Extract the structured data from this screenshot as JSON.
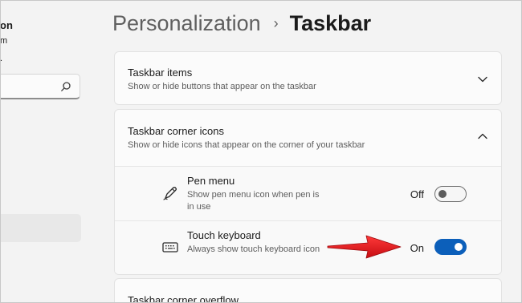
{
  "sidebar": {
    "user_name_fragment": "on",
    "user_sub_fragment": "m",
    "user_dot_fragment": ".",
    "search": {
      "value": "",
      "placeholder": ""
    }
  },
  "header": {
    "parent": "Personalization",
    "separator": "›",
    "current": "Taskbar"
  },
  "cards": {
    "taskbar_items": {
      "title": "Taskbar items",
      "description": "Show or hide buttons that appear on the taskbar"
    },
    "corner_icons": {
      "title": "Taskbar corner icons",
      "description": "Show or hide icons that appear on the corner of your taskbar",
      "rows": [
        {
          "title": "Pen menu",
          "description": "Show pen menu icon when pen is in use",
          "state_label": "Off",
          "enabled": false,
          "icon": "pen-icon"
        },
        {
          "title": "Touch keyboard",
          "description": "Always show touch keyboard icon",
          "state_label": "On",
          "enabled": true,
          "icon": "keyboard-icon"
        }
      ]
    },
    "corner_overflow": {
      "title": "Taskbar corner overflow"
    }
  },
  "colors": {
    "accent": "#0c5fba",
    "annotation_arrow": "#e8141b",
    "background": "#f3f3f3",
    "card": "#fbfbfb"
  }
}
